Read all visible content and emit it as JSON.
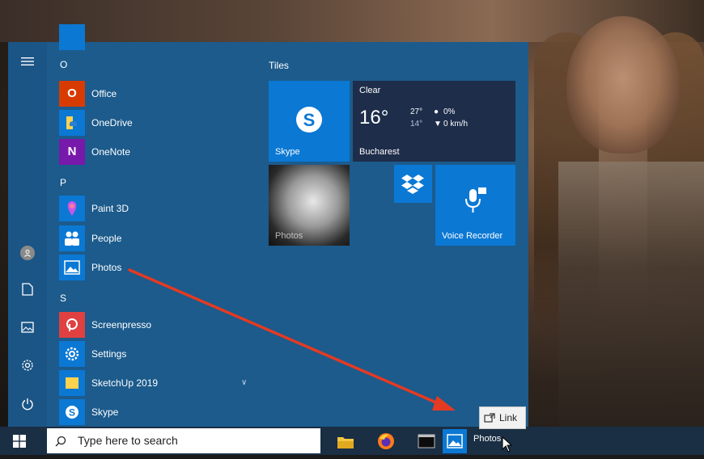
{
  "start_menu": {
    "rail": {
      "menu_icon": "hamburger-icon",
      "avatar_icon": "user-avatar-icon",
      "documents_icon": "document-icon",
      "pictures_icon": "pictures-icon",
      "settings_icon": "gear-icon",
      "power_icon": "power-icon"
    },
    "list": {
      "group_o": "O",
      "group_p": "P",
      "group_s": "S",
      "apps": [
        {
          "name": "Office",
          "icon": "office-icon",
          "color": "#d83b01"
        },
        {
          "name": "OneDrive",
          "icon": "onedrive-icon",
          "color": "#0b78d4"
        },
        {
          "name": "OneNote",
          "icon": "onenote-icon",
          "color": "#7719aa"
        },
        {
          "name": "Paint 3D",
          "icon": "paint3d-icon",
          "color": "#0b78d4"
        },
        {
          "name": "People",
          "icon": "people-icon",
          "color": "#0b78d4"
        },
        {
          "name": "Photos",
          "icon": "photos-icon",
          "color": "#0b78d4"
        },
        {
          "name": "Screenpresso",
          "icon": "screenpresso-icon",
          "color": "#e04040"
        },
        {
          "name": "Settings",
          "icon": "gear-icon",
          "color": "#0b78d4"
        },
        {
          "name": "SketchUp 2019",
          "icon": "folder-icon",
          "color": "#0b78d4"
        },
        {
          "name": "Skype",
          "icon": "skype-icon",
          "color": "#0b78d4"
        }
      ]
    },
    "tiles": {
      "title": "Tiles",
      "skype": {
        "label": "Skype",
        "icon": "skype-icon"
      },
      "weather": {
        "condition": "Clear",
        "temp": "16°",
        "high": "27°",
        "low": "14°",
        "precip": "0%",
        "wind": "0 km/h",
        "city": "Bucharest"
      },
      "photos": {
        "label": "Photos"
      },
      "dropbox": {
        "icon": "dropbox-icon"
      },
      "voice": {
        "label": "Voice Recorder",
        "icon": "microphone-icon"
      }
    }
  },
  "taskbar": {
    "start_icon": "windows-icon",
    "search_placeholder": "Type here to search",
    "search_icon": "search-icon",
    "pinned": [
      {
        "name": "file-explorer",
        "icon": "folder-icon"
      },
      {
        "name": "firefox",
        "icon": "firefox-icon"
      },
      {
        "name": "terminal",
        "icon": "terminal-icon"
      },
      {
        "name": "photos",
        "icon": "photos-icon"
      }
    ],
    "drag_label": "Photos"
  },
  "link_tooltip": {
    "label": "Link",
    "icon": "link-icon"
  },
  "colors": {
    "start_bg": "#1c5b8c",
    "tile_blue": "#0b78d4",
    "taskbar": "#1a2e44",
    "arrow": "#e53a22"
  }
}
